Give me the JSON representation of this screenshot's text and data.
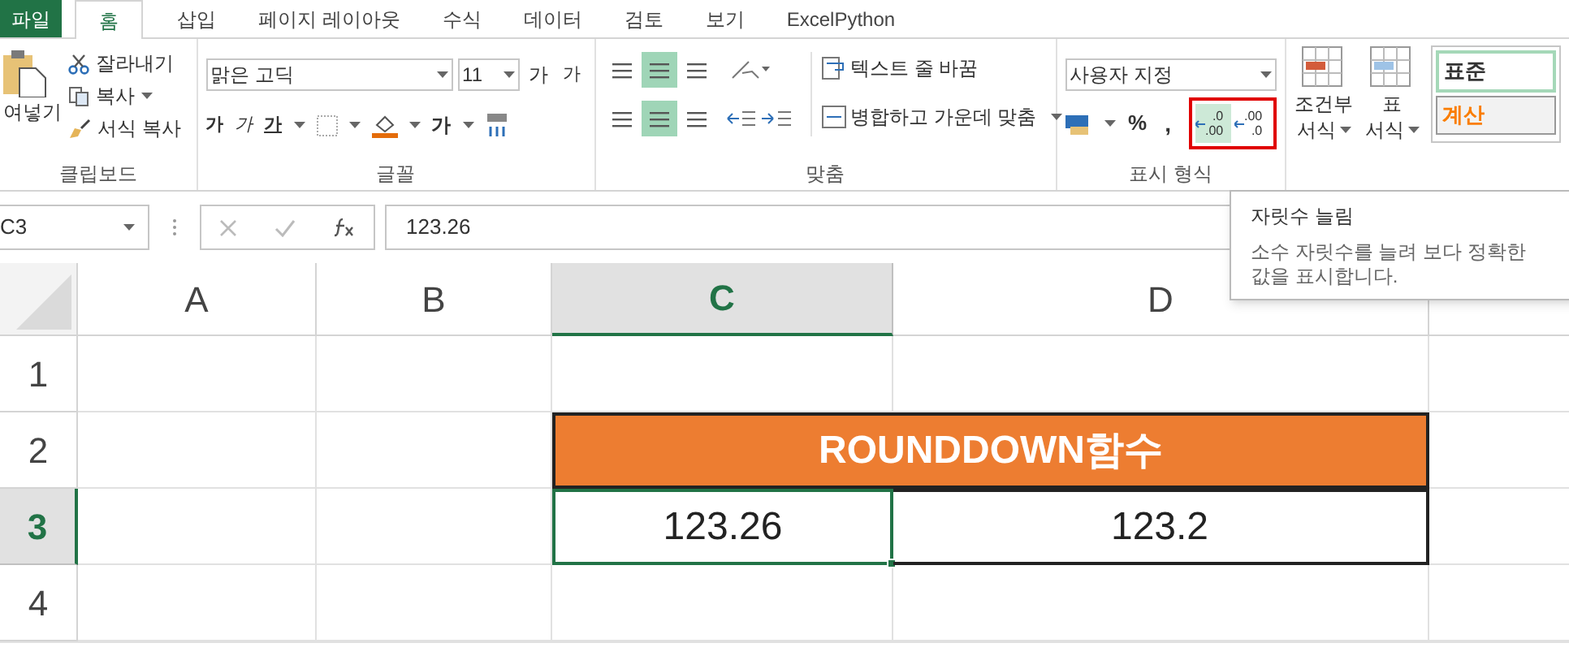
{
  "tabs": [
    {
      "label": "파일",
      "kind": "file",
      "selected": false
    },
    {
      "label": "홈",
      "kind": "tab",
      "selected": true
    },
    {
      "label": "삽입",
      "kind": "tab",
      "selected": false
    },
    {
      "label": "페이지 레이아웃",
      "kind": "tab",
      "selected": false
    },
    {
      "label": "수식",
      "kind": "tab",
      "selected": false
    },
    {
      "label": "데이터",
      "kind": "tab",
      "selected": false
    },
    {
      "label": "검토",
      "kind": "tab",
      "selected": false
    },
    {
      "label": "보기",
      "kind": "tab",
      "selected": false
    },
    {
      "label": "ExcelPython",
      "kind": "tab",
      "selected": false
    }
  ],
  "clipboard": {
    "paste": "여넣기",
    "cut": "잘라내기",
    "copy": "복사",
    "format_painter": "서식 복사",
    "label": "클립보드"
  },
  "font": {
    "name": "맑은 고딕",
    "size": "11",
    "grow": "가",
    "shrink": "가",
    "bold": "가",
    "italic": "가",
    "underline": "가",
    "font_color": "가",
    "label": "글꼴"
  },
  "alignment": {
    "vertical": [
      {
        "selected": false
      },
      {
        "selected": true
      },
      {
        "selected": false
      }
    ],
    "horizontal": [
      {
        "selected": false
      },
      {
        "selected": true
      },
      {
        "selected": false
      }
    ],
    "wrap": "텍스트 줄 바꿈",
    "merge": "병합하고 가운데 맞춤",
    "label": "맞춤"
  },
  "number": {
    "format": "사용자 지정",
    "percent": "%",
    "comma": ",",
    "increase_decimal": {
      "top": ".0",
      "bottom": ".00",
      "selected": true
    },
    "decrease_decimal": {
      "top": ".00",
      "bottom": ".0",
      "selected": false
    },
    "label": "표시 형식"
  },
  "styles": {
    "conditional": [
      "조건부",
      "서식"
    ],
    "table": [
      "표",
      "서식"
    ],
    "normal": "표준",
    "calc": "계산"
  },
  "formula_bar": {
    "name_box": "C3",
    "value": "123.26"
  },
  "tooltip": {
    "title": "자릿수 늘림",
    "body": "소수 자릿수를 늘려 보다 정확한 값을 표시합니다."
  },
  "sheet": {
    "columns": [
      {
        "label": "A",
        "selected": false
      },
      {
        "label": "B",
        "selected": false
      },
      {
        "label": "C",
        "selected": true
      },
      {
        "label": "D",
        "selected": false
      }
    ],
    "rows": [
      {
        "label": "1",
        "selected": false
      },
      {
        "label": "2",
        "selected": false
      },
      {
        "label": "3",
        "selected": true
      },
      {
        "label": "4",
        "selected": false
      }
    ],
    "title": "ROUNDDOWN함수",
    "cells": [
      {
        "text": "123.26",
        "selected": true
      },
      {
        "text": "123.2",
        "selected": false
      }
    ]
  }
}
